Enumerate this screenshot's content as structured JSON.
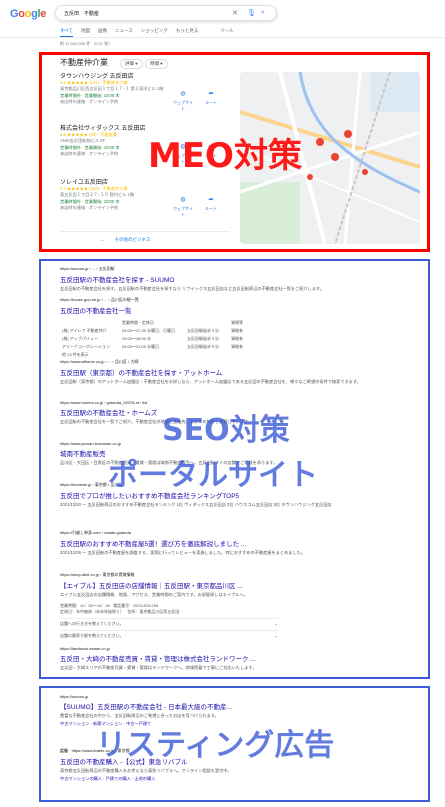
{
  "header": {
    "logo_letters": [
      "G",
      "o",
      "o",
      "g",
      "l",
      "e"
    ],
    "query": "五反田　不動産",
    "clear_icon": "close-icon",
    "mic_icon": "mic-icon",
    "search_icon": "search-icon",
    "tabs": [
      "すべて",
      "地図",
      "画像",
      "ニュース",
      "ショッピング",
      "もっと見る",
      "ツール"
    ],
    "stats": "約 37,000,000 件 （0.37 秒）"
  },
  "local_pack": {
    "title": "不動産仲介業",
    "filters": [
      "評価",
      "時間"
    ],
    "businesses": [
      {
        "name": "タウンハウジング 五反田店",
        "rating_line": "4.6 ★★★★★ (141) · 不動産仲介業",
        "address": "東京都品川区西五反田１丁目１７−１ 第２東洋ビル 1階",
        "hours": "営業時間外 · 営業開始: 10:00 木",
        "extra": "来店時の連絡 · オンライン予約"
      },
      {
        "name": "株式会社ヴィダックス 五反田店",
        "rating_line": "4.5 ★★★★★ (65) · 不動産業",
        "address": "ANIS五反田駅前ビル 5F",
        "hours": "営業時間外 · 営業開始: 10:00 木",
        "extra": "来店時の連絡 · オンライン予約"
      },
      {
        "name": "ソレイユ五反田店",
        "rating_line": "4.7 ★★★★★ (442) · 不動産仲介業",
        "address": "東五反田１丁目２７−１０ 野村ビル 1階",
        "hours": "営業時間外 · 営業開始: 10:00 木",
        "extra": "来店時の連絡 · オンライン予約"
      }
    ],
    "action_website": "ウェブサイト",
    "action_route": "ルート",
    "more_label": "その他のビジネス",
    "overlay_label": "MEO対策"
  },
  "organic": {
    "results": [
      {
        "cite": "https://suumo.jp › ... › 五反田駅",
        "title": "五反田駅の不動産会社を探す - SUUMO",
        "snippet": "五反田駅の不動産会社を探す。五反田駅の不動産会社を探すなら リブイックス五反田店など五反田駅周辺の不動産会社一覧をご紹介します。"
      },
      {
        "cite": "https://house.goo.ne.jp › ... › 品川区の駅一覧",
        "title": "五反田の不動産会社一覧",
        "snippet": ""
      },
      {
        "cite": "https://www.athome.co.jp › ... › 品川区 › 大崎",
        "title": "五反田駅（東京都）の不動産会社を探す・アットホーム",
        "snippet": "五反田駅（東京都）のアットホーム加盟店・不動産会社をお探しなら、アットホーム加盟店である五反田の不動産会社を、様々なご希望の条件で検索できます。"
      },
      {
        "cite": "https://www.homes.co.jp › gotanda_00375-st › list",
        "title": "五反田駅の不動産会社・ホームズ",
        "snippet": "五反田駅の不動産会社を一覧でご紹介。不動産会社の地図と連絡先、おすすめ物件を掲載しています。"
      },
      {
        "cite": "https://www.jounan-fudousan.co.jp",
        "title": "城南不動産販売",
        "snippet": "品川区・大田区・目黒区の不動産売買・賃貸・管理は城南不動産販売へ。五反田駅すぐの店舗でご相談を承ります。"
      },
      {
        "cite": "https://homesie.jp › 東京都 › 品川区",
        "title": "五反田でプロが推したいおすすめ不動産会社ランキングTOP5",
        "snippet": "2021/12/20 — 五反田駅周辺のおすすめ不動産会社ランキング 1位 ヴィダックス五反田店 2位 ハウスコム五反田店 3位 タウンハウジング五反田店"
      },
      {
        "cite": "https://引越し単身.com › estate-gotanda",
        "title": "五反田駅のおすすめ不動産屋5選！選び方を徹底解説しました ...",
        "snippet": "2021/12/26 — 五反田駅の不動産屋を調査する、実際に行ってレビューを実施しました。特におすすめの不動産屋をまとめました。"
      },
      {
        "cite": "https://shop.able.co.jp › 東京都の賃貸情報",
        "title": "【エイブル】五反田店の店舗情報｜五反田駅・東京都品川区 ...",
        "snippet": "エイブル五反田店の店舗情報、地図、アクセス、営業時間のご案内です。お部屋探しはエイブルへ。"
      },
      {
        "cite": "https://landwork-estate.co.jp",
        "title": "五反田・大崎の不動産売買・賃貸・管理は株式会社ランドワーク ...",
        "snippet": "五反田・大崎エリアの不動産売買・賃貸・管理はランドワークへ。地域密着で丁寧にご対応いたします。"
      }
    ],
    "table_headers": [
      "",
      "営業時間・定休日",
      "",
      "",
      "資格等"
    ],
    "table_rows": [
      [
        "(株) アイレフ 不動産仲介",
        "09:00〜17:30 水曜日、日曜日",
        "五反田駅徒歩３分",
        "資格有"
      ],
      [
        "(株) アップパリュー",
        "10:00〜18:00 水",
        "五反田駅徒歩３分",
        "資格有"
      ],
      [
        "アリーナコーポレーション",
        "09:00〜21:00 水曜日",
        "五反田駅徒歩５分",
        "資格有"
      ]
    ],
    "table_more": "他 13 件を表示",
    "able_details": [
      "営業時間：10：00〜18：30",
      "電話番号：0570-803-255",
      "定休日：年中無休（年末年始除く）",
      "住所：東京都品川区西五反田",
      "店舗への行き方を教えてください。",
      "店舗の最寄り駅を教えてください。"
    ],
    "overlay_line1": "SEO対策",
    "overlay_line2": "ポータルサイト"
  },
  "ads": {
    "results": [
      {
        "label": "",
        "cite": "https://suumo.jp",
        "title": "【SUUMO】五反田駅の不動産会社 - 日本最大級の不動産...",
        "snippet": "豊富な不動産会社の中から、五反田駅周辺のご希望に合ったお店を見つけられます。",
        "links": "中古マンション · 新築マンション · 中古一戸建て"
      },
      {
        "label": "広告",
        "cite": "https://www.livable.co.jp › 東京都",
        "title": "五反田の不動産購入 -【公式】東急リバブル",
        "snippet": "東京都五反田駅周辺の不動産購入をお考えなら東急リバブルへ。オンライン相談も受付中。",
        "links": "中古マンションの購入 · 戸建ての購入 · 土地の購入"
      }
    ],
    "overlay_label": "リスティング広告"
  },
  "colors": {
    "red_frame": "#ff0000",
    "blue_frame": "#3c5bd6",
    "overlay_red": "#ff1a1a",
    "link": "#1a0dab"
  }
}
